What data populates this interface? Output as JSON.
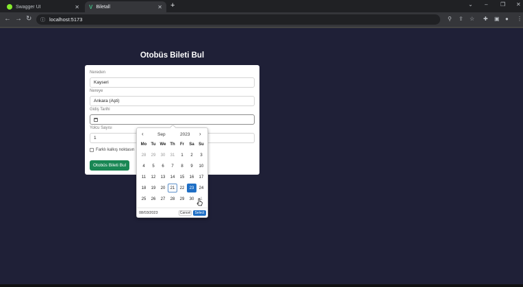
{
  "browser": {
    "tabs": [
      {
        "label": "Swagger UI",
        "icon": "swagger-favicon",
        "color": "#85ea2d"
      },
      {
        "label": "Biletall",
        "icon": "vue-favicon",
        "color": "#41b883"
      }
    ],
    "url": "localhost:5173",
    "close_glyph": "✕",
    "new_tab_glyph": "+"
  },
  "page": {
    "title": "Otobüs Bileti Bul",
    "from_label": "Nereden",
    "from_value": "Kayseri",
    "to_label": "Nereye",
    "to_value": "Ankara (Aşti)",
    "date_label": "Gidiş Tarihi",
    "passenger_label": "Yolcu Sayısı",
    "passenger_value": "1",
    "checkbox_label": "Farklı kalkış noktasın",
    "submit_label": "Otobüs Bileti Bul",
    "accent": "#198754"
  },
  "datepicker": {
    "month": "Sep",
    "year": "2023",
    "prev": "‹",
    "next": "›",
    "weekdays": [
      "Mo",
      "Tu",
      "We",
      "Th",
      "Fr",
      "Sa",
      "Su"
    ],
    "weeks": [
      [
        "28",
        "29",
        "30",
        "31",
        "1",
        "2",
        "3"
      ],
      [
        "4",
        "5",
        "6",
        "7",
        "8",
        "9",
        "10"
      ],
      [
        "11",
        "12",
        "13",
        "14",
        "15",
        "16",
        "17"
      ],
      [
        "18",
        "19",
        "20",
        "21",
        "22",
        "23",
        "24"
      ],
      [
        "25",
        "26",
        "27",
        "28",
        "29",
        "30",
        "1"
      ]
    ],
    "outside_days": [
      [
        0,
        0
      ],
      [
        0,
        1
      ],
      [
        0,
        2
      ],
      [
        0,
        3
      ],
      [
        4,
        6
      ]
    ],
    "today": [
      3,
      3
    ],
    "selected": [
      3,
      5
    ],
    "selected_date": "08/03/2023",
    "cancel_label": "Cancel",
    "select_label": "Select",
    "accent": "#1f6fc5"
  }
}
